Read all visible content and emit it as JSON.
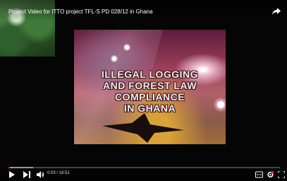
{
  "video": {
    "title": "Project Video for ITTO project TFL-S PD 028/12 in Ghana",
    "headline_lines": [
      "ILLEGAL LOGGING",
      "AND FOREST LAW",
      "COMPLIANCE",
      "IN GHANA"
    ],
    "current_time": "0:03",
    "duration": "18:51",
    "time_display": "0:03 / 18:51",
    "progress_fraction": 0.003,
    "buffered_fraction": 0.09
  },
  "icons": [
    "share-icon",
    "play-icon",
    "next-icon",
    "volume-icon",
    "subtitles-icon",
    "settings-icon",
    "fullscreen-icon"
  ],
  "colors": {
    "progress_played": "#ff0000",
    "background": "#000000"
  }
}
